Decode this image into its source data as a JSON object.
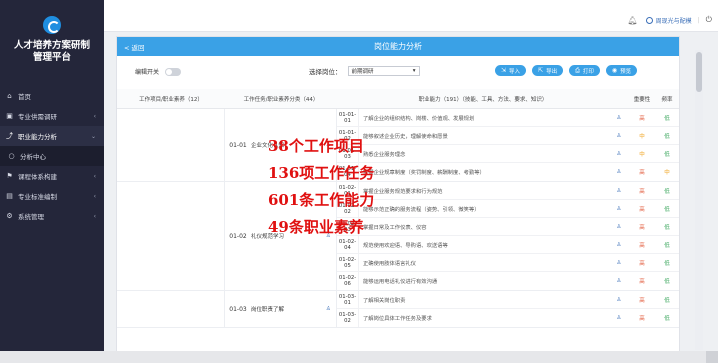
{
  "app": {
    "title_line1": "人才培养方案研制",
    "title_line2": "管理平台"
  },
  "sidebar": {
    "items": [
      {
        "label": "首页",
        "icon": "home-icon"
      },
      {
        "label": "专业供需调研",
        "icon": "survey-icon"
      },
      {
        "label": "职业能力分析",
        "icon": "analysis-icon"
      },
      {
        "label": "分析中心",
        "icon": "circle-icon"
      },
      {
        "label": "课程体系构建",
        "icon": "flag-icon"
      },
      {
        "label": "专业标准编制",
        "icon": "standard-icon"
      },
      {
        "label": "系统管理",
        "icon": "gear-icon"
      }
    ]
  },
  "topbar": {
    "user": "周现光与配模",
    "separator": "|"
  },
  "panel": {
    "back": "< 返回",
    "title": "岗位能力分析",
    "switch_label": "编辑开关",
    "select_label": "选择岗位：",
    "select_value": "前期调研",
    "buttons": [
      {
        "label": "导入",
        "icon": "import-icon"
      },
      {
        "label": "导出",
        "icon": "export-icon"
      },
      {
        "label": "打印",
        "icon": "print-icon"
      },
      {
        "label": "预览",
        "icon": "preview-icon"
      }
    ]
  },
  "table": {
    "headers": {
      "project": "工作项目/职业素养（12）",
      "task": "工作任务/职业素养分类（44）",
      "ability": "职业能力（191）（技能、工具、方法、要求、知识）",
      "importance": "重要性",
      "frequency": "频率"
    },
    "groups": [
      {
        "code": "01-01",
        "name": "企业文化认知",
        "rows": [
          {
            "code": "01-01-01",
            "desc": "了解企业的组织结构、岗楼、价值观、发展规划",
            "imp": "高",
            "freq": "低"
          },
          {
            "code": "01-01-02",
            "desc": "能够叙述企业历史，理解使命和愿景",
            "imp": "中",
            "freq": "低"
          },
          {
            "code": "01-01-03",
            "desc": "熟悉企业服务理念",
            "imp": "中",
            "freq": "低"
          },
          {
            "code": "01-01-04",
            "desc": "掌握企业规章制度（奖罚制度、薪酬制度、考勤等）",
            "imp": "高",
            "freq": "中"
          }
        ]
      },
      {
        "code": "01-02",
        "name": "礼仪规范学习",
        "rows": [
          {
            "code": "01-02-01",
            "desc": "掌握企业服务规范要求和行为规范",
            "imp": "高",
            "freq": "低"
          },
          {
            "code": "01-02-02",
            "desc": "能够示范正确的服务流程（姿势、引领、微笑等）",
            "imp": "高",
            "freq": "低"
          },
          {
            "code": "01-02-03",
            "desc": "掌握日常及工作仪表、仪容",
            "imp": "高",
            "freq": "低"
          },
          {
            "code": "01-02-04",
            "desc": "规范使用欢迎语、导购语、欢送语等",
            "imp": "高",
            "freq": "低"
          },
          {
            "code": "01-02-05",
            "desc": "正确使用肢体语言礼仪",
            "imp": "高",
            "freq": "低"
          },
          {
            "code": "01-02-06",
            "desc": "能够运用电话礼仪进行有效沟通",
            "imp": "高",
            "freq": "低"
          }
        ]
      },
      {
        "code": "01-03",
        "name": "岗位职责了解",
        "rows": [
          {
            "code": "01-03-01",
            "desc": "了解相关岗位职责",
            "imp": "高",
            "freq": "低"
          },
          {
            "code": "01-03-02",
            "desc": "了解岗位具体工作任务及要求",
            "imp": "高",
            "freq": "低"
          }
        ]
      }
    ]
  },
  "overlay": {
    "stats": [
      "38个工作项目",
      "136项工作任务",
      "601条工作能力",
      "49条职业素养"
    ]
  },
  "colors": {
    "sidebar_bg": "#24263a",
    "accent": "#3aa1e6",
    "overlay_red": "#e01010",
    "high": "#e25a3b",
    "mid": "#f0a21a",
    "low": "#3aa65c"
  }
}
